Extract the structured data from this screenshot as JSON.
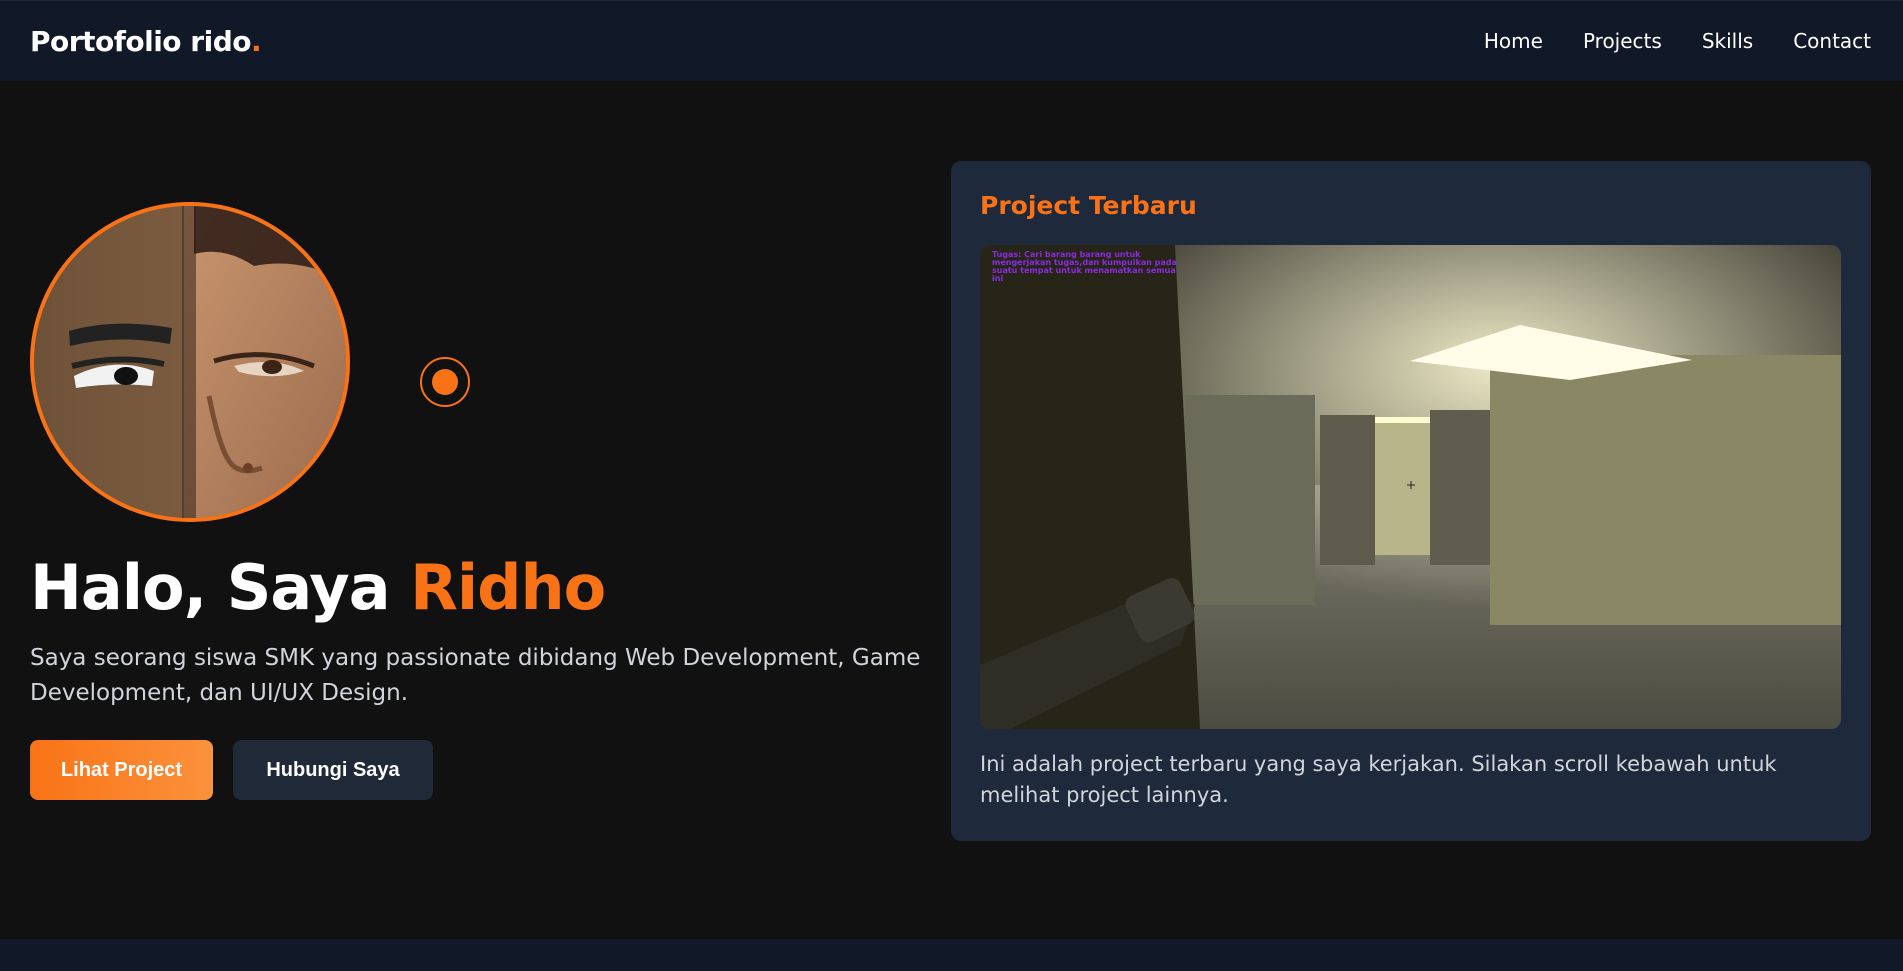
{
  "nav": {
    "brand": "Portofolio rido",
    "brand_dot": ".",
    "links": [
      "Home",
      "Projects",
      "Skills",
      "Contact"
    ]
  },
  "hero": {
    "greeting": "Halo, Saya ",
    "name": "Ridho",
    "description": "Saya seorang siswa SMK yang passionate dibidang Web Development, Game Development, dan UI/UX Design.",
    "primary_button": "Lihat Project",
    "secondary_button": "Hubungi Saya"
  },
  "project_card": {
    "title": "Project Terbaru",
    "hud_text": "Tugas: Cari barang barang untuk mengerjakan tugas,dan kumpulkan pada suatu tempat untuk menamatkan semua ini",
    "description": "Ini adalah project terbaru yang saya kerjakan. Silakan scroll kebawah untuk melihat project lainnya."
  },
  "colors": {
    "accent": "#f97316",
    "background": "#111111",
    "navbar": "#111827",
    "card": "#1e293b"
  },
  "icons": {
    "radio": "radio-dot-icon"
  }
}
